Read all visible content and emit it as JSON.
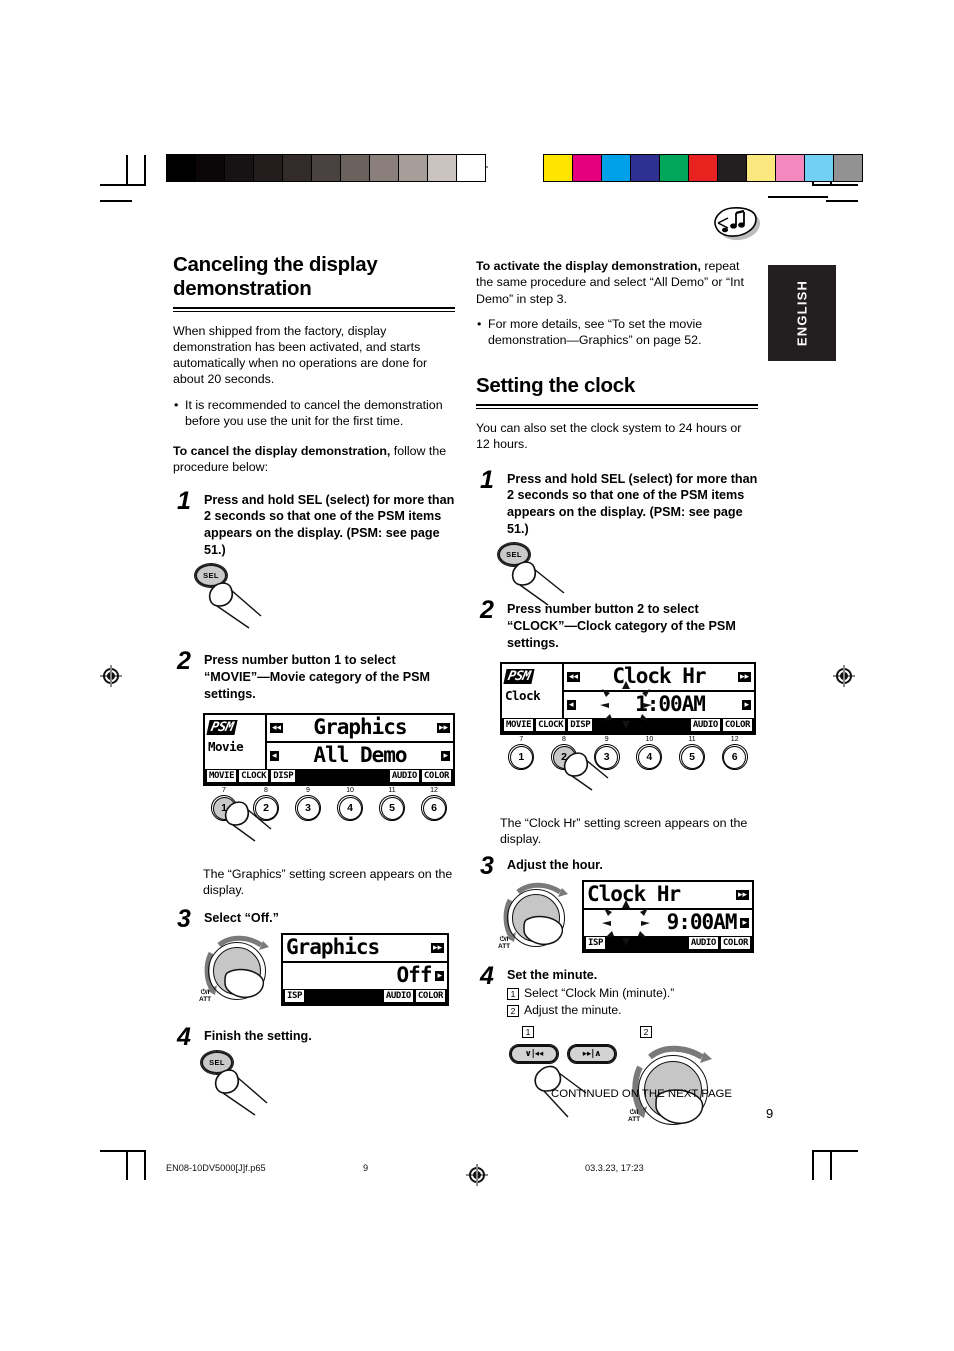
{
  "document": {
    "language_tab": "ENGLISH",
    "page_number": "9",
    "continued_note": "CONTINUED ON THE NEXT PAGE",
    "print_filename": "EN08-10DV5000[J]f.p65",
    "print_page": "9",
    "print_timestamp": "03.3.23, 17:23"
  },
  "colorbar": {
    "grayscale": [
      "#000000",
      "#0b0708",
      "#171213",
      "#241d1e",
      "#332b2a",
      "#4a4240",
      "#6b615d",
      "#8a7f7b",
      "#a79d99",
      "#cbc3bf",
      "#ffffff"
    ],
    "colors": [
      "#ffe400",
      "#e5007e",
      "#00a0e9",
      "#2e3192",
      "#00a65a",
      "#e8231f",
      "#231f20",
      "#fbe87f",
      "#f489c0",
      "#72d0f4",
      "#929292"
    ]
  },
  "left_column": {
    "heading": "Canceling the display demonstration",
    "intro": "When shipped from the factory, display demonstration has been activated, and starts automatically when no operations are done for about 20 seconds.",
    "intro_bullet": "It is recommended to cancel the demonstration before you use the unit for the first time.",
    "lead_bold": "To cancel the display demonstration,",
    "lead_rest": " follow the procedure below:",
    "steps": [
      {
        "number": "1",
        "text": "Press and hold SEL (select) for more than 2 seconds so that one of the PSM items appears on the display. (PSM: see page 51.)",
        "button_label": "SEL"
      },
      {
        "number": "2",
        "text": "Press number button 1 to select “MOVIE”—Movie category of the PSM settings.",
        "caption": "The “Graphics” setting screen appears on the display."
      },
      {
        "number": "3",
        "text": "Select “Off.”"
      },
      {
        "number": "4",
        "text": "Finish the setting.",
        "button_label": "SEL"
      }
    ],
    "lcd_movie": {
      "psm_logo": "PSM",
      "category": "Movie",
      "line1": "Graphics",
      "line2": "All Demo",
      "left_arrow_1": "◂◂",
      "right_arrow_1": "▸▸",
      "left_arrow_2": "◂",
      "right_arrow_2": "▸",
      "tabs": [
        "MOVIE",
        "CLOCK",
        "DISP",
        "",
        "AUDIO",
        "COLOR"
      ],
      "active_tab": "MOVIE",
      "tab_numbers": [
        "7",
        "8",
        "9",
        "10",
        "11",
        "12"
      ],
      "buttons": [
        "1",
        "2",
        "3",
        "4",
        "5",
        "6"
      ],
      "pressed_button": "1"
    },
    "lcd_off": {
      "line1": "Graphics",
      "line2": "Off",
      "right_arrow_1": "▸▸",
      "right_arrow_2": "▸",
      "tabs": [
        "ISP",
        "",
        "AUDIO",
        "COLOR"
      ],
      "knob_label_top": "⏻/I",
      "knob_label_bottom": "ATT"
    }
  },
  "right_column": {
    "activate_bold": "To activate the display demonstration,",
    "activate_rest": " repeat the same procedure and select “All Demo” or “Int Demo” in step 3.",
    "activate_bullet": "For more details, see “To set the movie demonstration—Graphics” on page 52.",
    "heading": "Setting the clock",
    "intro": "You can also set the clock system to 24 hours or 12 hours.",
    "steps": [
      {
        "number": "1",
        "text": "Press and hold SEL (select) for more than 2 seconds so that one of the PSM items appears on the display. (PSM: see page 51.)",
        "button_label": "SEL"
      },
      {
        "number": "2",
        "text": "Press number button 2 to select “CLOCK”—Clock category of the PSM settings.",
        "caption": "The “Clock Hr” setting screen appears on the display."
      },
      {
        "number": "3",
        "text": "Adjust the hour."
      },
      {
        "number": "4",
        "text": "Set the minute.",
        "substeps": [
          {
            "marker": "1",
            "text": "Select “Clock Min (minute).”"
          },
          {
            "marker": "2",
            "text": "Adjust the minute."
          }
        ],
        "figure_markers": [
          "1",
          "2"
        ]
      }
    ],
    "lcd_clock": {
      "psm_logo": "PSM",
      "category": "Clock",
      "line1": "Clock Hr",
      "line2": "1:00AM",
      "left_arrow_1": "◂◂",
      "right_arrow_1": "▸▸",
      "left_arrow_2": "◂",
      "right_arrow_2": "▸",
      "tabs": [
        "MOVIE",
        "CLOCK",
        "DISP",
        "",
        "AUDIO",
        "COLOR"
      ],
      "active_tab": "CLOCK",
      "tab_numbers": [
        "7",
        "8",
        "9",
        "10",
        "11",
        "12"
      ],
      "buttons": [
        "1",
        "2",
        "3",
        "4",
        "5",
        "6"
      ],
      "pressed_button": "2"
    },
    "lcd_hour": {
      "line1": "Clock Hr",
      "line2": "9:00AM",
      "right_arrow_1": "▸▸",
      "right_arrow_2": "▸",
      "tabs": [
        "ISP",
        "",
        "AUDIO",
        "COLOR"
      ],
      "knob_label_top": "⏻/I",
      "knob_label_bottom": "ATT"
    },
    "minute_controls": {
      "button_left": "∨|◂◂",
      "button_right": "▸▸|∧",
      "knob_label_top": "⏻/I",
      "knob_label_bottom": "ATT"
    }
  }
}
